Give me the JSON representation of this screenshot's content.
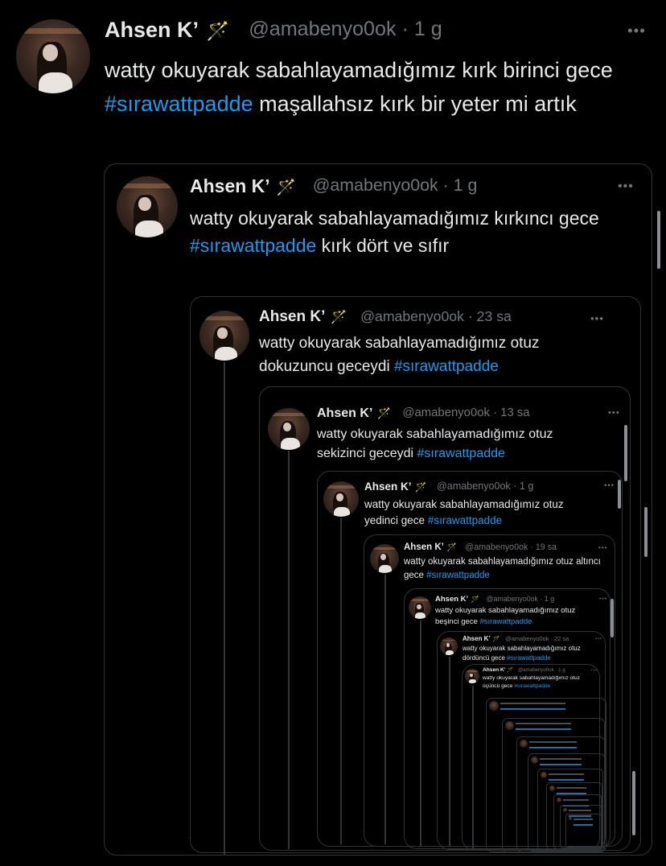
{
  "tweets": [
    {
      "name": "Ahsen K’",
      "emoji": "🪄",
      "handle": "@amabenyo0ok",
      "time": "· 1 g",
      "text_pre": "watty okuyarak sabahlayamadığımız kırk birinci gece ",
      "hashtag": "#sırawattpadde",
      "text_post": " maşallahsız kırk bir yeter mi artık"
    },
    {
      "name": "Ahsen K’",
      "emoji": "🪄",
      "handle": "@amabenyo0ok",
      "time": "· 1 g",
      "text_pre": "watty okuyarak sabahlayamadığımız kırkıncı gece ",
      "hashtag": "#sırawattpadde",
      "text_post": " kırk dört ve sıfır"
    },
    {
      "name": "Ahsen K’",
      "emoji": "🪄",
      "handle": "@amabenyo0ok",
      "time": "· 23 sa",
      "text_pre": "watty okuyarak sabahlayamadığımız otuz dokuzuncu geceydi ",
      "hashtag": "#sırawattpadde",
      "text_post": ""
    },
    {
      "name": "Ahsen K’",
      "emoji": "🪄",
      "handle": "@amabenyo0ok",
      "time": "· 13 sa",
      "text_pre": "watty okuyarak sabahlayamadığımız otuz sekizinci geceydi ",
      "hashtag": "#sırawattpadde",
      "text_post": ""
    },
    {
      "name": "Ahsen K’",
      "emoji": "🪄",
      "handle": "@amabenyo0ok",
      "time": "· 1 g",
      "text_pre": "watty okuyarak sabahlayamadığımız otuz yedinci gece ",
      "hashtag": "#sırawattpadde",
      "text_post": ""
    },
    {
      "name": "Ahsen K’",
      "emoji": "🪄",
      "handle": "@amabenyo0ok",
      "time": "· 19 sa",
      "text_pre": "watty okuyarak sabahlayamadığımız otuz altıncı gece ",
      "hashtag": "#sırawattpadde",
      "text_post": ""
    },
    {
      "name": "Ahsen K’",
      "emoji": "🪄",
      "handle": "@amabenyo0ok",
      "time": "· 1 g",
      "text_pre": "watty okuyarak sabahlayamadığımız otuz beşinci gece ",
      "hashtag": "#sırawattpadde",
      "text_post": ""
    },
    {
      "name": "Ahsen K’",
      "emoji": "🪄",
      "handle": "@amabenyo0ok",
      "time": "· 22 sa",
      "text_pre": "watty okuyarak sabahlayamadığımız otuz dördüncü gece ",
      "hashtag": "#sırawattpadde",
      "text_post": ""
    },
    {
      "name": "Ahsen K’",
      "emoji": "🪄",
      "handle": "@amabenyo0ok",
      "time": "· 1 g",
      "text_pre": "watty okuyarak sabahlayamadığımız otuz üçüncü gece ",
      "hashtag": "#sırawattpadde",
      "text_post": ""
    }
  ],
  "more_icon": "•••",
  "colors": {
    "hashtag": "#1d9bf0",
    "handle": "#71767b",
    "border": "#2f3336"
  }
}
